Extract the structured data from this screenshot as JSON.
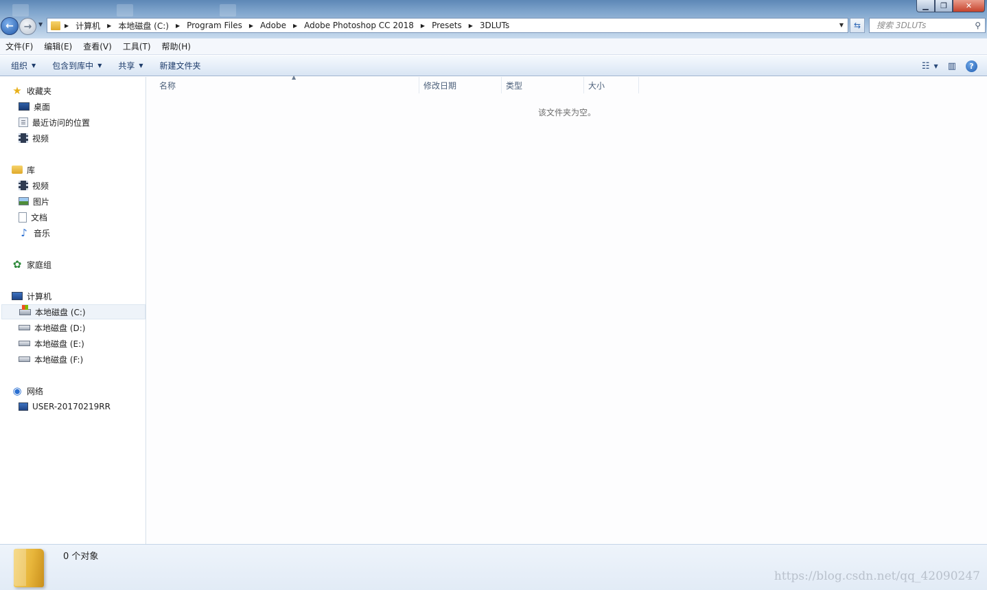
{
  "window": {
    "minimize": "▁",
    "maximize": "❐",
    "close": "✕"
  },
  "address": {
    "crumbs": [
      "计算机",
      "本地磁盘 (C:)",
      "Program Files",
      "Adobe",
      "Adobe Photoshop CC 2018",
      "Presets",
      "3DLUTs"
    ]
  },
  "search": {
    "placeholder": "搜索 3DLUTs"
  },
  "menu": [
    "文件(F)",
    "编辑(E)",
    "查看(V)",
    "工具(T)",
    "帮助(H)"
  ],
  "toolbar": {
    "organize": "组织",
    "include_library": "包含到库中",
    "share": "共享",
    "new_folder": "新建文件夹"
  },
  "sidebar": {
    "favorites": "收藏夹",
    "favorites_items": [
      "桌面",
      "最近访问的位置",
      "视频"
    ],
    "libraries": "库",
    "library_items": [
      "视频",
      "图片",
      "文档",
      "音乐"
    ],
    "homegroup": "家庭组",
    "computer": "计算机",
    "drives": [
      "本地磁盘 (C:)",
      "本地磁盘 (D:)",
      "本地磁盘 (E:)",
      "本地磁盘 (F:)"
    ],
    "network": "网络",
    "network_items": [
      "USER-20170219RR"
    ]
  },
  "columns": {
    "name": "名称",
    "modified": "修改日期",
    "type": "类型",
    "size": "大小"
  },
  "main": {
    "empty": "该文件夹为空。"
  },
  "status": {
    "count": "0 个对象"
  },
  "watermark": "https://blog.csdn.net/qq_42090247"
}
